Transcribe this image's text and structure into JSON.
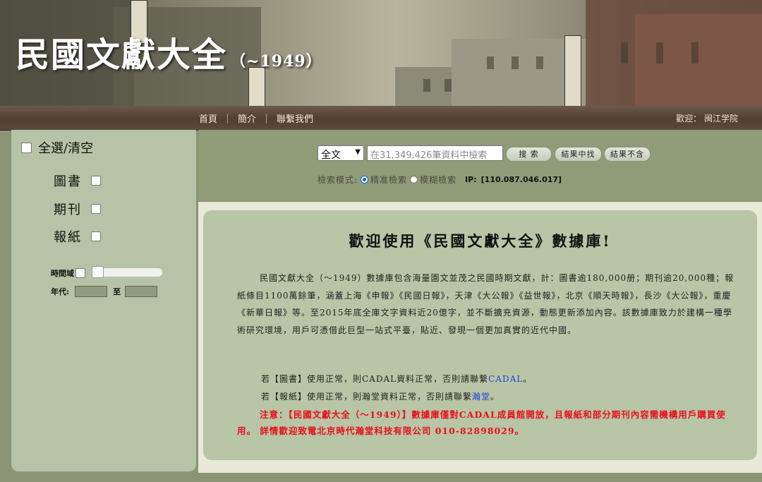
{
  "header": {
    "title": "民國文獻大全",
    "title_suffix": "（~1949）"
  },
  "nav": {
    "items": [
      "首頁",
      "簡介",
      "聯繫我們"
    ],
    "welcome": "歡迎： 闽江学院"
  },
  "sidebar": {
    "select_all_label": "全選/清空",
    "categories": [
      "圖書",
      "期刊",
      "報紙"
    ],
    "time_label": "時間域",
    "year_label": "年代:",
    "to_label": "至"
  },
  "search": {
    "scope": "全文",
    "placeholder": "在31,349,426筆資料中檢索",
    "buttons": [
      "搜 索",
      "結果中找",
      "結果不含"
    ],
    "mode_label": "檢索模式:",
    "modes": [
      "精准檢索",
      "模糊檢索"
    ],
    "selected_mode": "精准檢索",
    "ip_label": "IP:",
    "ip_value": "[110.087.046.017]"
  },
  "content": {
    "heading": "歡迎使用《民國文獻大全》數據庫!",
    "intro": "民國文獻大全（～1949）數據庫包含海量園文並茂之民國時期文獻，計：圖書逾180,000册；期刊逾20,000種；報紙條目1100萬餘筆，涵蓋上海《申報》《民國日報》，天津《大公報》《益世報》，北京《順天時報》，長沙《大公報》，重慶《新華日報》等。至2015年底全庫文字資料近20億字，並不斷擴充資源，動態更新添加內容。該數據庫致力於建構一種學術研究環境，用戶可憑借此巨型一站式平臺，貼近、發現一個更加真實的近代中國。",
    "book_note_pre": "若【圖書】使用正常，則CADAL資料正常，否則請聯繫",
    "book_link": "CADAL",
    "book_note_post": "。",
    "paper_note_pre": "若【報紙】使用正常，則瀚堂資料正常，否則請聯繫",
    "paper_link": "瀚堂",
    "paper_note_post": "。",
    "notice": "注意：【民國文獻大全（～1949）】數據庫僅對CADAL成員館開放，且報紙和部分期刊內容需機構用戶購買使用。 詳情歡迎致電北京時代瀚堂科技有限公司 010-82898029。"
  },
  "colors": {
    "nav_bg": "#4f3e33",
    "panel_bg": "#b8c5a6",
    "search_bg": "#909b77",
    "notice": "#e8101a",
    "link": "#1f3fd6"
  },
  "icons": {
    "dropdown": "chevron-down-icon",
    "radio_selected": "radio-selected-icon"
  }
}
